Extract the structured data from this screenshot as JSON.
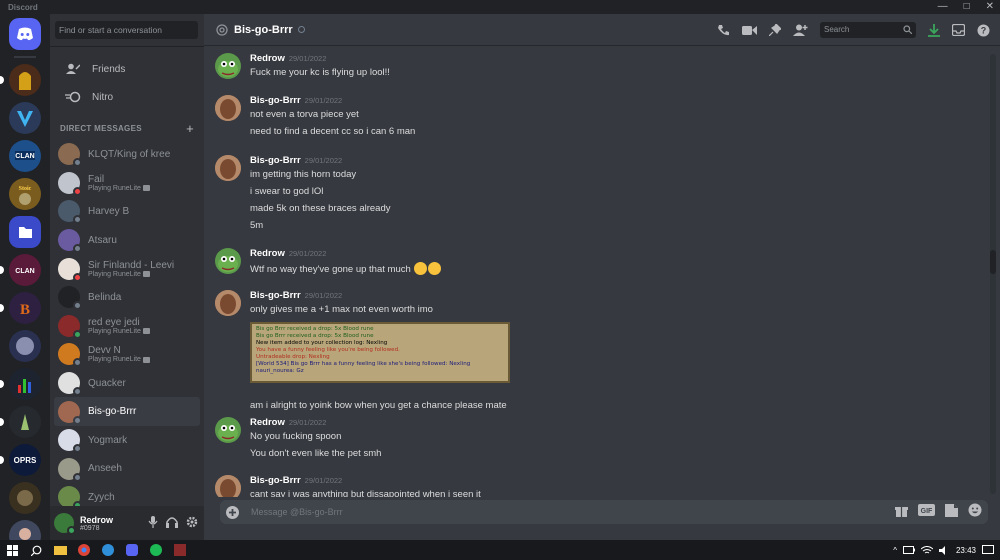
{
  "app": {
    "title": "Discord"
  },
  "sidebar": {
    "search_placeholder": "Find or start a conversation",
    "nav": [
      {
        "label": "Friends",
        "icon": "friends-icon"
      },
      {
        "label": "Nitro",
        "icon": "nitro-icon"
      }
    ],
    "dm_header": "DIRECT MESSAGES",
    "dms": [
      {
        "name": "KLQT/King of kree",
        "sub": "",
        "status": "off"
      },
      {
        "name": "Fail",
        "sub": "Playing RuneLite",
        "status": "dnd"
      },
      {
        "name": "Harvey B",
        "sub": "",
        "status": "off"
      },
      {
        "name": "Atsaru",
        "sub": "",
        "status": "off"
      },
      {
        "name": "Sir Finlandd - Leevi",
        "sub": "Playing RuneLite",
        "status": "dnd"
      },
      {
        "name": "Belinda",
        "sub": "",
        "status": "off"
      },
      {
        "name": "red eye jedi",
        "sub": "Playing RuneLite",
        "status": "on"
      },
      {
        "name": "Devv N",
        "sub": "Playing RuneLite",
        "status": "off"
      },
      {
        "name": "Quacker",
        "sub": "",
        "status": "off"
      },
      {
        "name": "Bis-go-Brrr",
        "sub": "",
        "status": "off",
        "active": true
      },
      {
        "name": "Yogmark",
        "sub": "",
        "status": "off"
      },
      {
        "name": "Anseeh",
        "sub": "",
        "status": "off"
      },
      {
        "name": "Zyych",
        "sub": "",
        "status": "on"
      }
    ]
  },
  "user": {
    "name": "Redrow",
    "tag": "#0978"
  },
  "header": {
    "channel": "Bis-go-Brrr",
    "search_placeholder": "Search"
  },
  "messages": [
    {
      "author": "Redrow",
      "timestamp": "29/01/2022",
      "lines": [
        "Fuck me your kc is flying up lool!!"
      ]
    },
    {
      "author": "Bis-go-Brrr",
      "timestamp": "29/01/2022",
      "lines": [
        "not even a torva piece yet",
        "need to find a decent cc so i can 6 man"
      ]
    },
    {
      "author": "Bis-go-Brrr",
      "timestamp": "29/01/2022",
      "lines": [
        "im getting this horn today",
        "i swear to god lOl",
        "made 5k on these braces already",
        "5m"
      ]
    },
    {
      "author": "Redrow",
      "timestamp": "29/01/2022",
      "lines": [
        "Wtf no way they've gone up that much"
      ]
    },
    {
      "author": "Bis-go-Brrr",
      "timestamp": "29/01/2022",
      "lines": [
        "only gives me a +1 max not even worth imo",
        "am i alright to yoink bow when you get a chance please mate"
      ]
    },
    {
      "author": "Redrow",
      "timestamp": "29/01/2022",
      "lines": [
        "No you fucking spoon",
        "You don't even like the pet smh"
      ]
    },
    {
      "author": "Bis-go-Brrr",
      "timestamp": "29/01/2022",
      "lines": [
        "cant say i was anything but dissapointed when i seen it"
      ]
    }
  ],
  "attachment_lines": [
    {
      "text": "Bis go Brrr received a drop: 5x Blood rune",
      "color": "#1d5e1d"
    },
    {
      "text": "Bis go Brrr received a drop: 5x Blood rune",
      "color": "#1d5e1d"
    },
    {
      "text": "New item added to your collection log: Nexling",
      "color": "#000000"
    },
    {
      "text": "You have a funny feeling like you're being followed.",
      "color": "#b22d1f"
    },
    {
      "text": "Untradeable drop: Nexling",
      "color": "#b22d1f"
    },
    {
      "text": "[World 534] Bis go Brrr has a funny feeling like she's being followed: Nexling",
      "color": "#1a1a7a"
    },
    {
      "text": "nauri_nourea: Gz",
      "color": "#1a1a7a"
    }
  ],
  "composer": {
    "placeholder": "Message @Bis-go-Brrr"
  },
  "taskbar": {
    "time": "23:43"
  },
  "colors": {
    "blurple": "#5865f2",
    "online": "#3ba55d",
    "dnd": "#ed4245",
    "offline": "#747f8d"
  }
}
